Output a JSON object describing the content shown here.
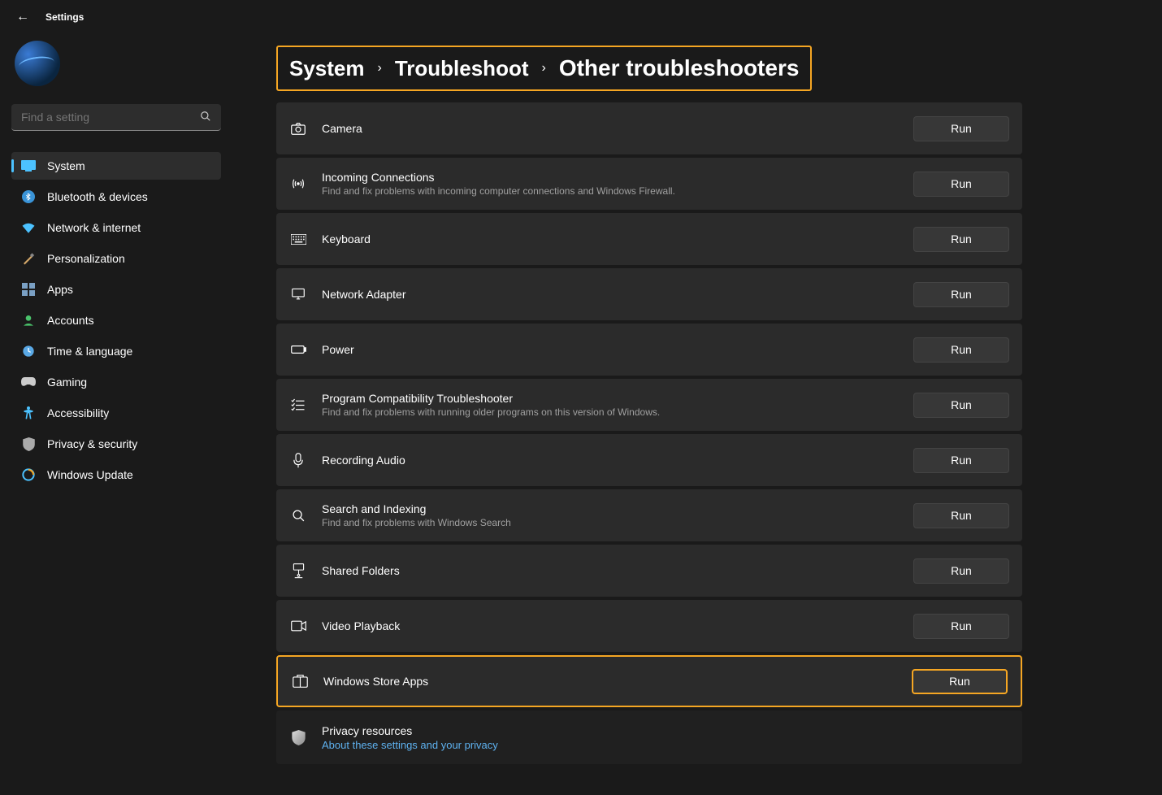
{
  "window": {
    "title": "Settings"
  },
  "search": {
    "placeholder": "Find a setting"
  },
  "nav": {
    "items": [
      {
        "id": "system",
        "label": "System"
      },
      {
        "id": "bluetooth",
        "label": "Bluetooth & devices"
      },
      {
        "id": "network",
        "label": "Network & internet"
      },
      {
        "id": "personalization",
        "label": "Personalization"
      },
      {
        "id": "apps",
        "label": "Apps"
      },
      {
        "id": "accounts",
        "label": "Accounts"
      },
      {
        "id": "time",
        "label": "Time & language"
      },
      {
        "id": "gaming",
        "label": "Gaming"
      },
      {
        "id": "accessibility",
        "label": "Accessibility"
      },
      {
        "id": "privacy",
        "label": "Privacy & security"
      },
      {
        "id": "update",
        "label": "Windows Update"
      }
    ]
  },
  "breadcrumb": {
    "level1": "System",
    "level2": "Troubleshoot",
    "level3": "Other troubleshooters"
  },
  "buttons": {
    "run": "Run"
  },
  "troubleshooters": [
    {
      "id": "camera",
      "title": "Camera",
      "sub": ""
    },
    {
      "id": "incoming",
      "title": "Incoming Connections",
      "sub": "Find and fix problems with incoming computer connections and Windows Firewall."
    },
    {
      "id": "keyboard",
      "title": "Keyboard",
      "sub": ""
    },
    {
      "id": "netadapter",
      "title": "Network Adapter",
      "sub": ""
    },
    {
      "id": "power",
      "title": "Power",
      "sub": ""
    },
    {
      "id": "compat",
      "title": "Program Compatibility Troubleshooter",
      "sub": "Find and fix problems with running older programs on this version of Windows."
    },
    {
      "id": "recaudio",
      "title": "Recording Audio",
      "sub": ""
    },
    {
      "id": "search",
      "title": "Search and Indexing",
      "sub": "Find and fix problems with Windows Search"
    },
    {
      "id": "shared",
      "title": "Shared Folders",
      "sub": ""
    },
    {
      "id": "video",
      "title": "Video Playback",
      "sub": ""
    },
    {
      "id": "store",
      "title": "Windows Store Apps",
      "sub": ""
    }
  ],
  "privacy": {
    "title": "Privacy resources",
    "link": "About these settings and your privacy"
  }
}
